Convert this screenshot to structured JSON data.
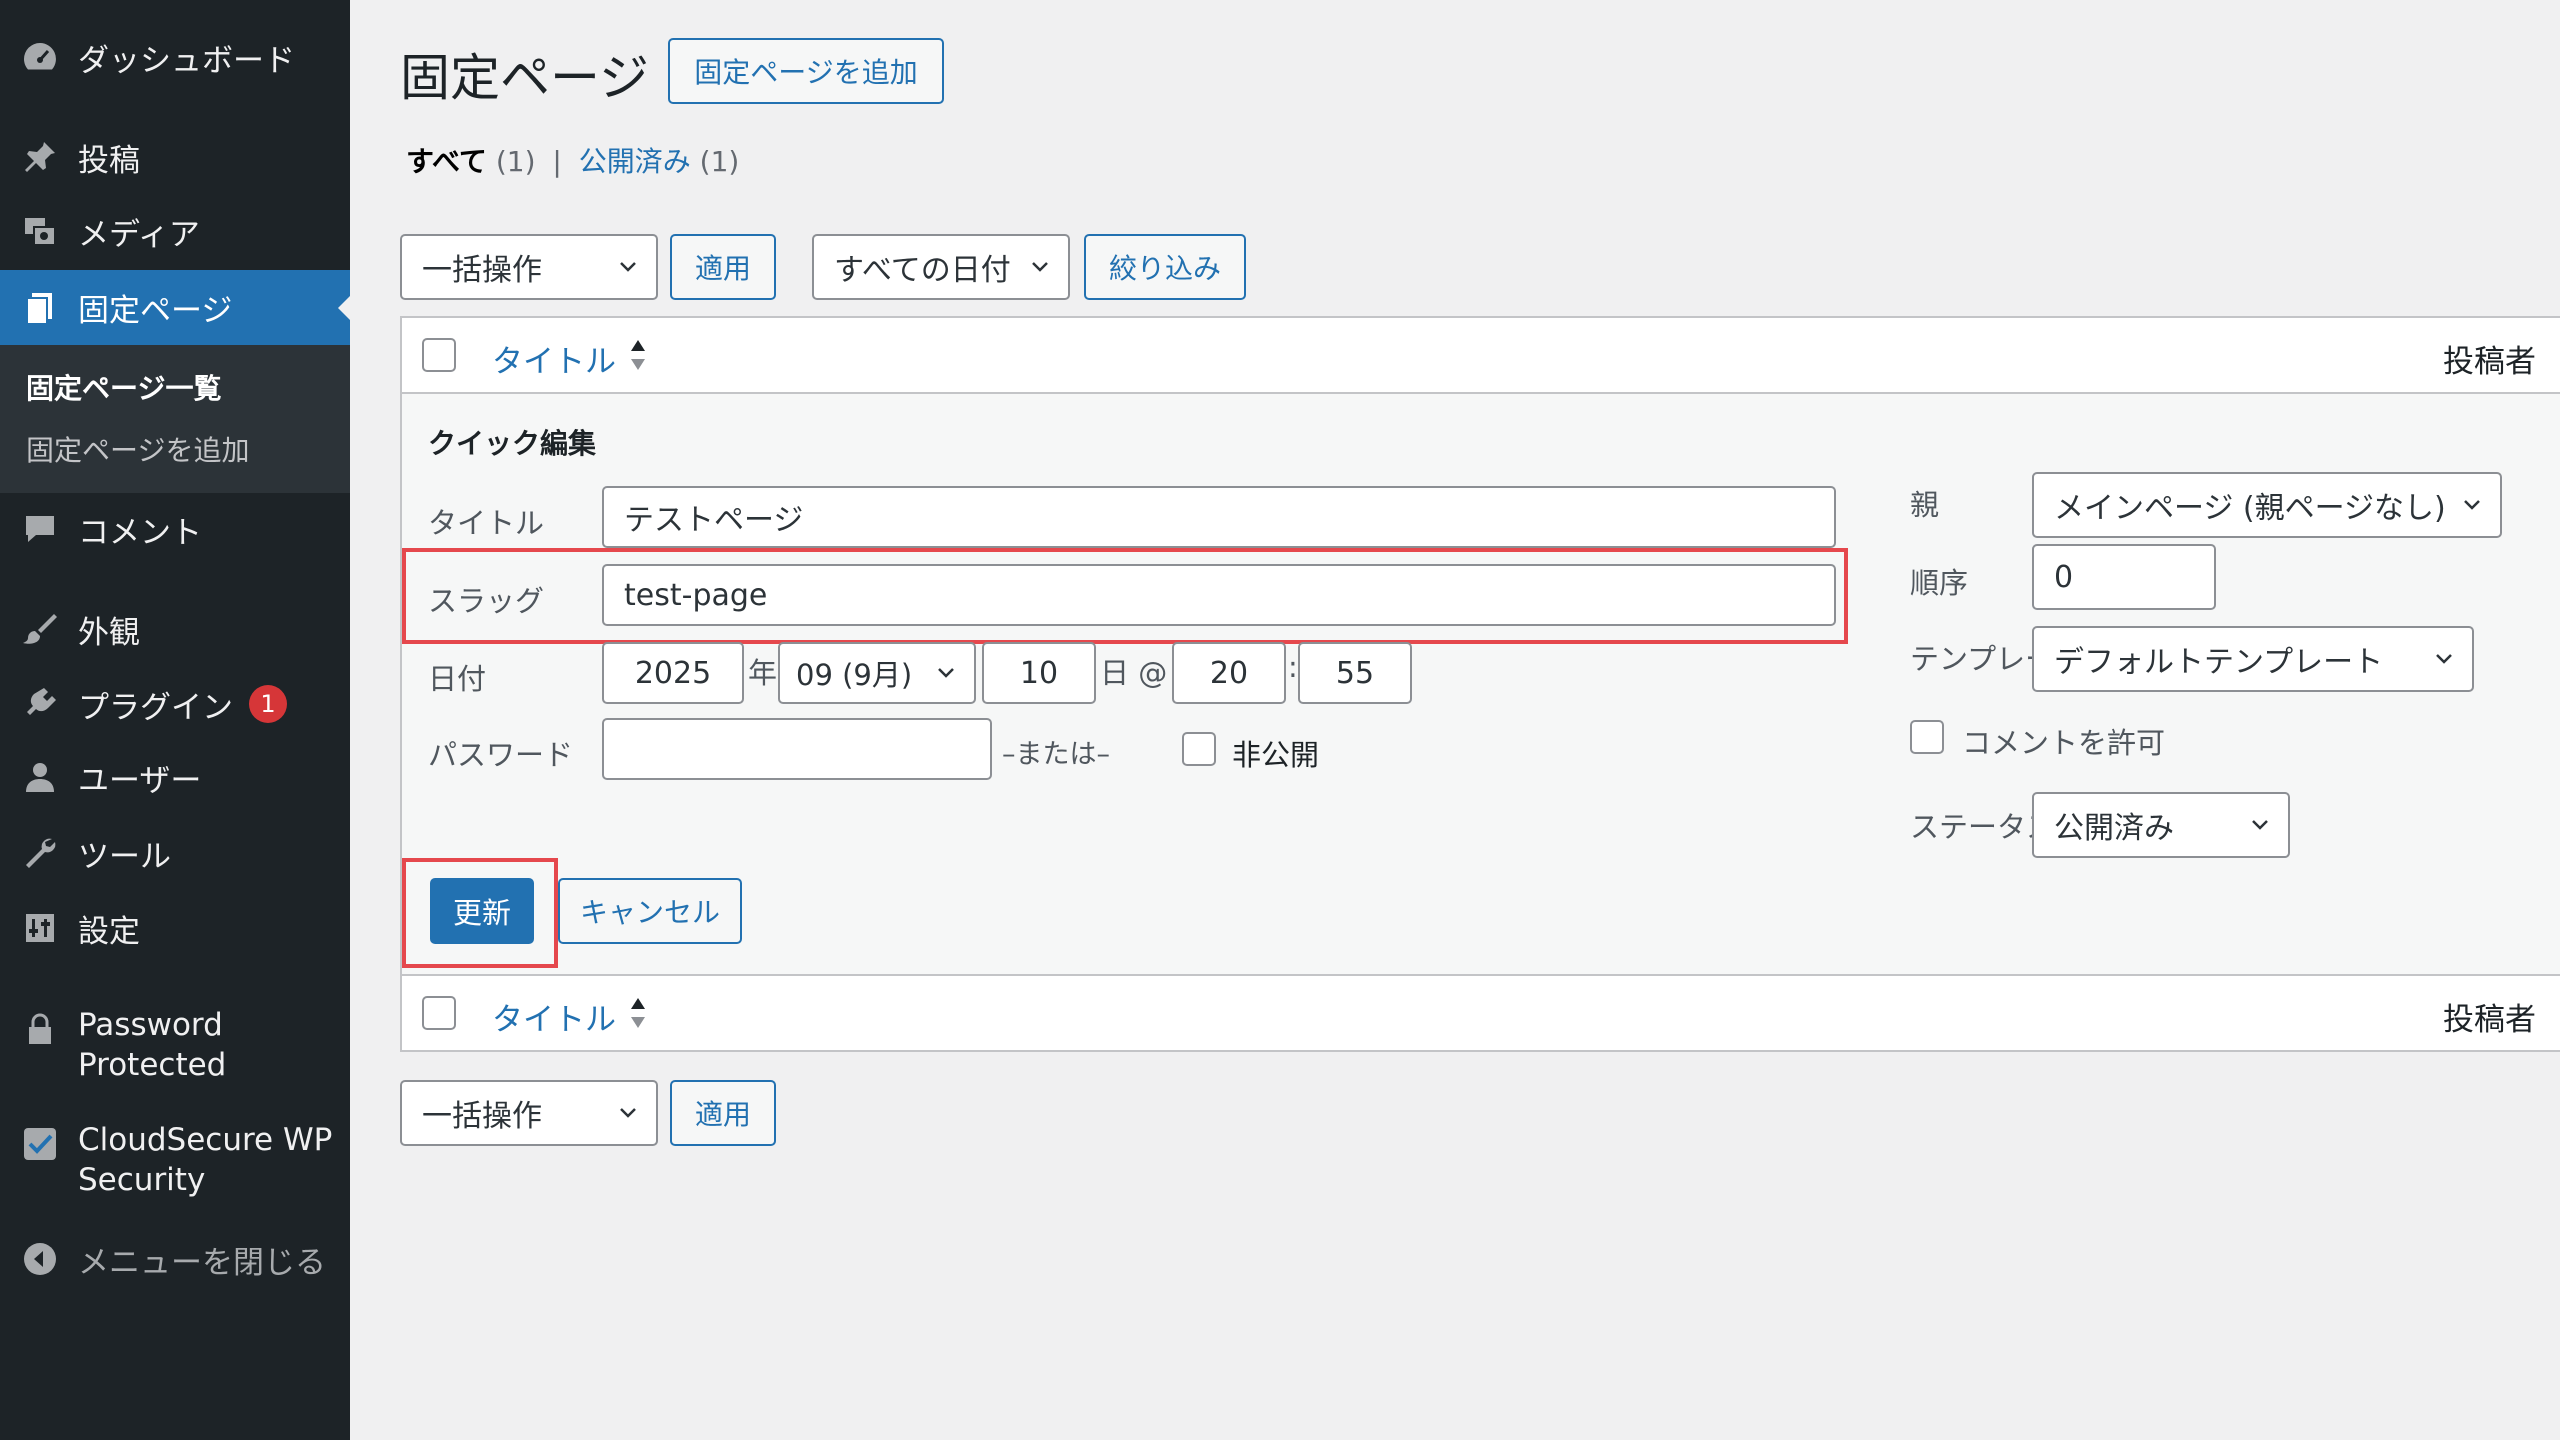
{
  "sidebar": {
    "dashboard": "ダッシュボード",
    "posts": "投稿",
    "media": "メディア",
    "pages": "固定ページ",
    "pages_list": "固定ページ一覧",
    "pages_add": "固定ページを追加",
    "comments": "コメント",
    "appearance": "外観",
    "plugins": "プラグイン",
    "plugins_badge": "1",
    "users": "ユーザー",
    "tools": "ツール",
    "settings": "設定",
    "password_protected_line1": "Password",
    "password_protected_line2": "Protected",
    "cloudsecure_line1": "CloudSecure WP",
    "cloudsecure_line2": "Security",
    "collapse": "メニューを閉じる"
  },
  "header": {
    "title": "固定ページ",
    "add_new": "固定ページを追加"
  },
  "filters": {
    "all": "すべて",
    "all_count": "(1)",
    "separator": "|",
    "published": "公開済み",
    "published_count": "(1)"
  },
  "toolbar": {
    "bulk_action": "一括操作",
    "apply": "適用",
    "all_dates": "すべての日付",
    "filter": "絞り込み"
  },
  "table": {
    "col_title": "タイトル",
    "col_author": "投稿者"
  },
  "quick_edit": {
    "legend": "クイック編集",
    "title_label": "タイトル",
    "title_value": "テストページ",
    "slug_label": "スラッグ",
    "slug_value": "test-page",
    "date_label": "日付",
    "year": "2025",
    "year_suffix": "年",
    "month": "09 (9月)",
    "day": "10",
    "day_suffix": "日 @",
    "hour": "20",
    "time_sep": ":",
    "minute": "55",
    "password_label": "パスワード",
    "password_value": "",
    "or_text": "–または–",
    "private_label": "非公開",
    "parent_label": "親",
    "parent_value": "メインページ (親ページなし)",
    "order_label": "順序",
    "order_value": "0",
    "template_label": "テンプレート",
    "template_value": "デフォルトテンプレート",
    "allow_comments_label": "コメントを許可",
    "status_label": "ステータス",
    "status_value": "公開済み",
    "update_button": "更新",
    "cancel_button": "キャンセル"
  },
  "colors": {
    "sidebar_bg": "#1d2327",
    "accent": "#2271b1",
    "highlight": "#e5484d",
    "badge": "#d63638"
  },
  "icons": [
    "dashboard-icon",
    "pin-icon",
    "media-icon",
    "pages-icon",
    "comment-icon",
    "brush-icon",
    "plugin-icon",
    "user-icon",
    "wrench-icon",
    "settings-icon",
    "lock-icon",
    "shield-check-icon",
    "collapse-icon",
    "chevron-down-icon",
    "sort-icon"
  ]
}
